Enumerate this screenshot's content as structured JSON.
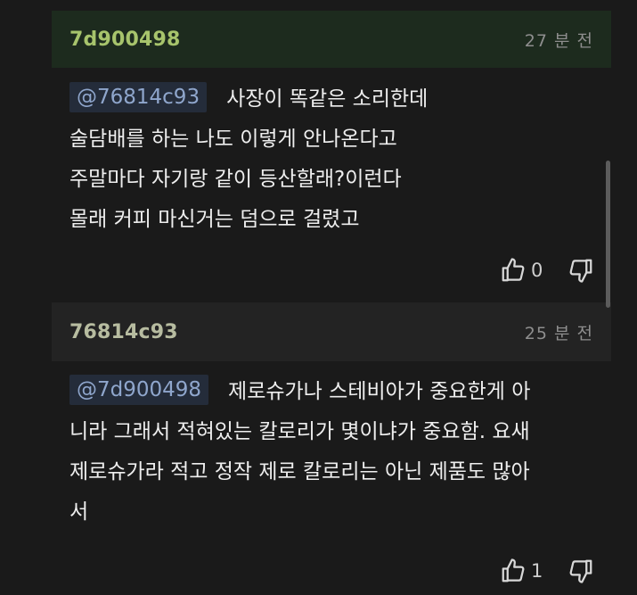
{
  "comments": [
    {
      "username": "7d900498",
      "time": "27 분 전",
      "mention": "@76814c93",
      "lines": [
        "사장이 똑같은 소리한데",
        "술담배를 하는 나도 이렇게 안나온다고",
        "주말마다 자기랑 같이 등산할래?이런다",
        "몰래 커피 마신거는 덤으로 걸렸고"
      ],
      "likes": "0",
      "like_icon": "thumbs-up-icon",
      "dislike_icon": "thumbs-down-icon"
    },
    {
      "username": "76814c93",
      "time": "25 분 전",
      "mention": "@7d900498",
      "lines": [
        "제로슈가나 스테비아가 중요한게 아",
        "니라 그래서 적혀있는 칼로리가 몇이냐가 중요함. 요새",
        "제로슈가라 적고 정작 제로 칼로리는 아닌 제품도 많아",
        "서"
      ],
      "likes": "1",
      "like_icon": "thumbs-up-icon",
      "dislike_icon": "thumbs-down-icon"
    }
  ],
  "colors": {
    "background": "#1a1a1a",
    "header_highlight": "#1d2b1e",
    "username_green": "#a7c46c",
    "mention_blue": "#8fa6cc"
  }
}
